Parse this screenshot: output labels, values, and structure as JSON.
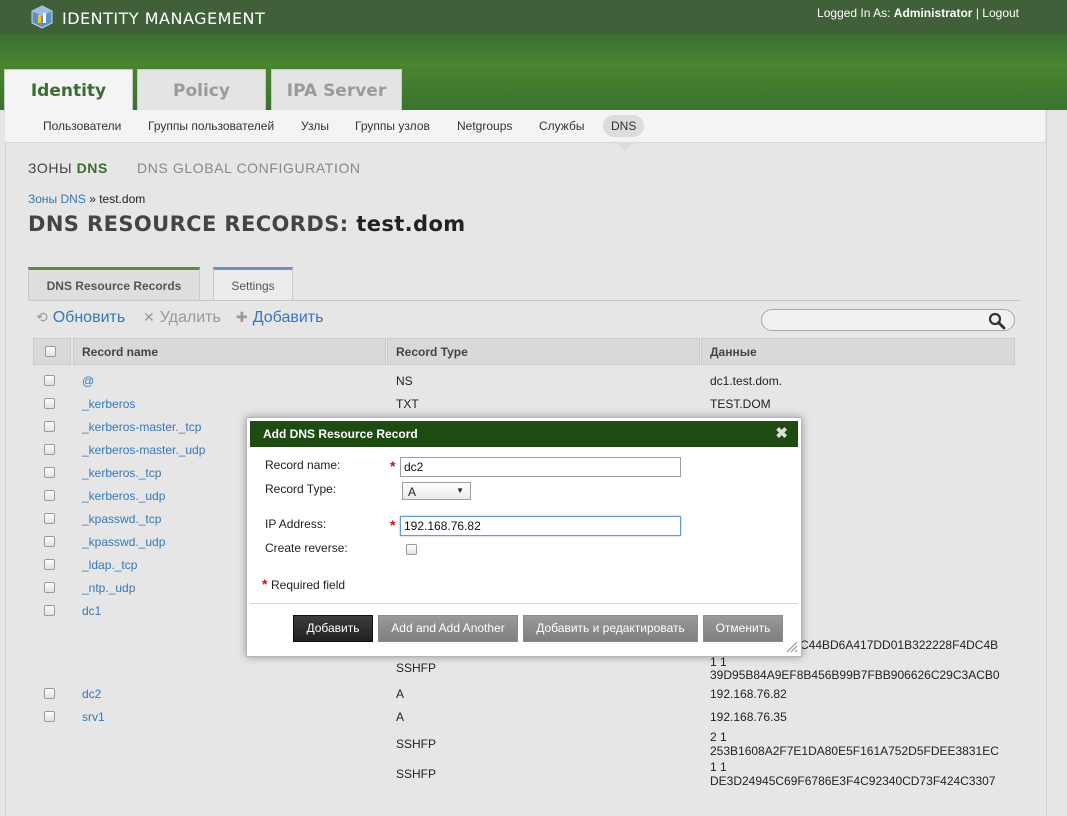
{
  "header": {
    "brand": "IDENTITY MANAGEMENT",
    "logged_in_label": "Logged In As:",
    "user": "Administrator",
    "separator": "|",
    "logout": "Logout"
  },
  "main_tabs": [
    {
      "label": "Identity",
      "active": true
    },
    {
      "label": "Policy",
      "active": false
    },
    {
      "label": "IPA Server",
      "active": false
    }
  ],
  "subnav": [
    {
      "label": "Пользователи"
    },
    {
      "label": "Группы пользователей"
    },
    {
      "label": "Узлы"
    },
    {
      "label": "Группы узлов"
    },
    {
      "label": "Netgroups"
    },
    {
      "label": "Службы"
    },
    {
      "label": "DNS",
      "active": true
    }
  ],
  "facets": {
    "zones_prefix": "ЗОНЫ",
    "zones_strong": "DNS",
    "global": "DNS GLOBAL CONFIGURATION"
  },
  "breadcrumb": {
    "link": "Зоны DNS",
    "sep": "»",
    "current": "test.dom"
  },
  "page_title": {
    "prefix": "DNS RESOURCE RECORDS:",
    "name": "test.dom"
  },
  "section_tabs": [
    {
      "label": "DNS Resource Records",
      "active": true
    },
    {
      "label": "Settings",
      "active": false
    }
  ],
  "actions": {
    "refresh": "Обновить",
    "delete": "Удалить",
    "add": "Добавить"
  },
  "search": {
    "value": "",
    "placeholder": ""
  },
  "table": {
    "columns": [
      "Record name",
      "Record Type",
      "Данные"
    ],
    "rows": [
      {
        "name": "@",
        "type": "NS",
        "data": "dc1.test.dom."
      },
      {
        "name": "_kerberos",
        "type": "TXT",
        "data": "TEST.DOM"
      },
      {
        "name": "_kerberos-master._tcp",
        "type": "",
        "data": ""
      },
      {
        "name": "_kerberos-master._udp",
        "type": "",
        "data": ""
      },
      {
        "name": "_kerberos._tcp",
        "type": "",
        "data": ""
      },
      {
        "name": "_kerberos._udp",
        "type": "",
        "data": ""
      },
      {
        "name": "_kpasswd._tcp",
        "type": "",
        "data": ""
      },
      {
        "name": "_kpasswd._udp",
        "type": "",
        "data": ""
      },
      {
        "name": "_ldap._tcp",
        "type": "",
        "data": ""
      },
      {
        "name": "_ntp._udp",
        "type": "",
        "data": ""
      },
      {
        "name": "dc1",
        "type": "",
        "data": ""
      },
      {
        "name": "",
        "type": "",
        "data": "C44BD6A417DD01B322228F4DC4B"
      },
      {
        "name": "",
        "type": "SSHFP",
        "data": "1 1"
      },
      {
        "name": "",
        "type": "",
        "data": "39D95B84A9EF8B456B99B7FBB906626C29C3ACB0"
      },
      {
        "name": "dc2",
        "type": "A",
        "data": "192.168.76.82"
      },
      {
        "name": "srv1",
        "type": "A",
        "data": "192.168.76.35"
      },
      {
        "name": "",
        "type": "SSHFP",
        "data": "2 1"
      },
      {
        "name": "",
        "type": "",
        "data": "253B1608A2F7E1DA80E5F161A752D5FDEE3831EC"
      },
      {
        "name": "",
        "type": "SSHFP",
        "data": "1 1"
      },
      {
        "name": "",
        "type": "",
        "data": "DE3D24945C69F6786E3F4C92340CD73F424C3307"
      }
    ]
  },
  "dialog": {
    "title": "Add DNS Resource Record",
    "close": "✖",
    "record_name_label": "Record name:",
    "record_name_value": "dc2",
    "record_type_label": "Record Type:",
    "record_type_value": "A",
    "ip_label": "IP Address:",
    "ip_value": "192.168.76.82",
    "reverse_label": "Create reverse:",
    "required_mark": "*",
    "required_text": "Required field",
    "buttons": {
      "add": "Добавить",
      "add_another": "Add and Add Another",
      "add_edit": "Добавить и редактировать",
      "cancel": "Отменить"
    }
  },
  "colors": {
    "header_dark": "#40603a",
    "header_green": "#49862f",
    "dialog_header": "#1d4b12",
    "link": "#3577b8",
    "required": "#cc1111"
  }
}
